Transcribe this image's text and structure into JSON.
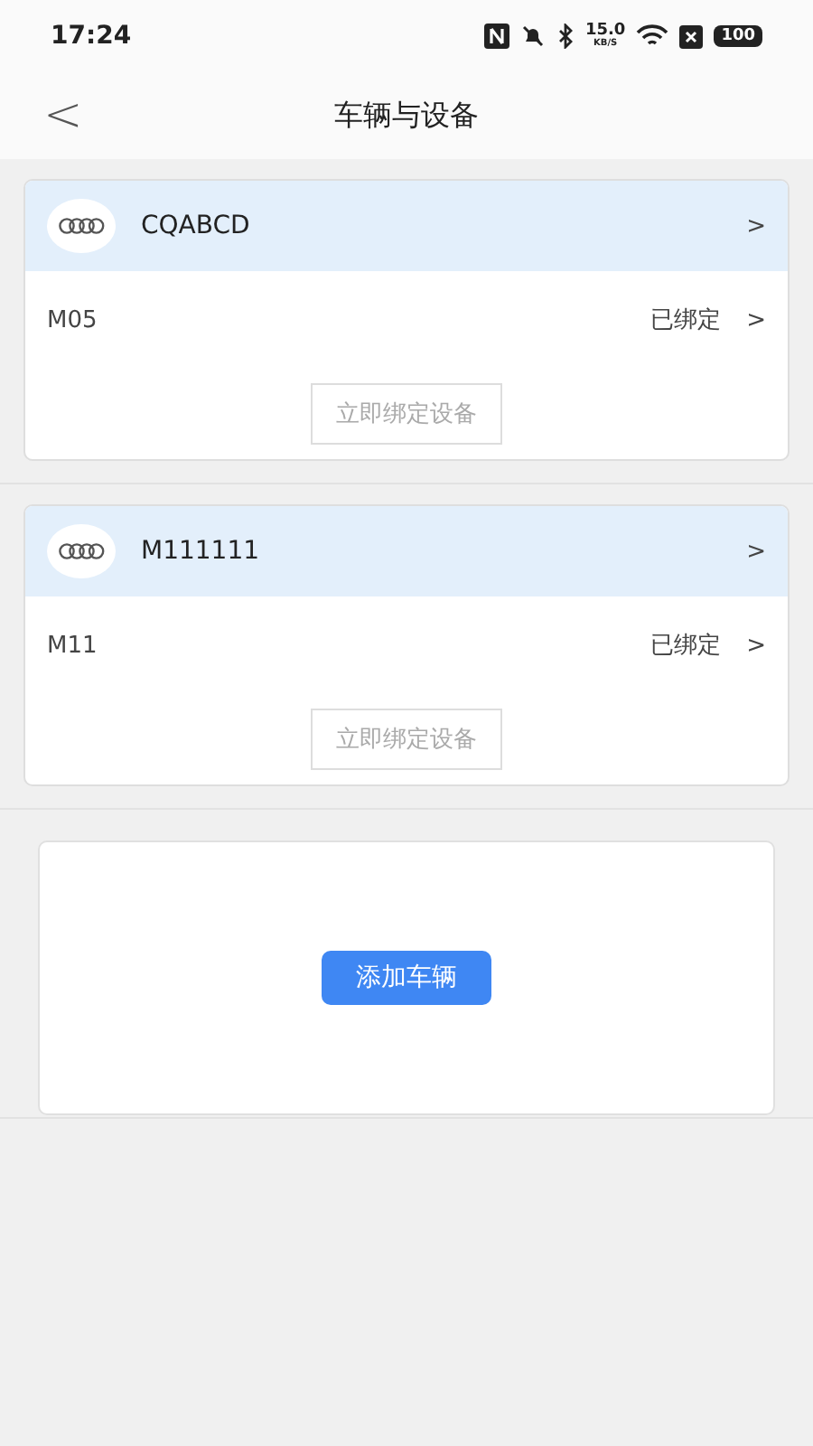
{
  "status_bar": {
    "time": "17:24",
    "net_speed": "15.0",
    "net_unit": "KB/S",
    "battery": "100"
  },
  "header": {
    "back": "<",
    "title": "车辆与设备"
  },
  "vehicles": [
    {
      "plate": "CQABCD",
      "chevron": ">",
      "device": "M05",
      "status": "已绑定",
      "status_chevron": ">",
      "bind_button": "立即绑定设备"
    },
    {
      "plate": "M111111",
      "chevron": ">",
      "device": "M11",
      "status": "已绑定",
      "status_chevron": ">",
      "bind_button": "立即绑定设备"
    }
  ],
  "add_button": "添加车辆"
}
